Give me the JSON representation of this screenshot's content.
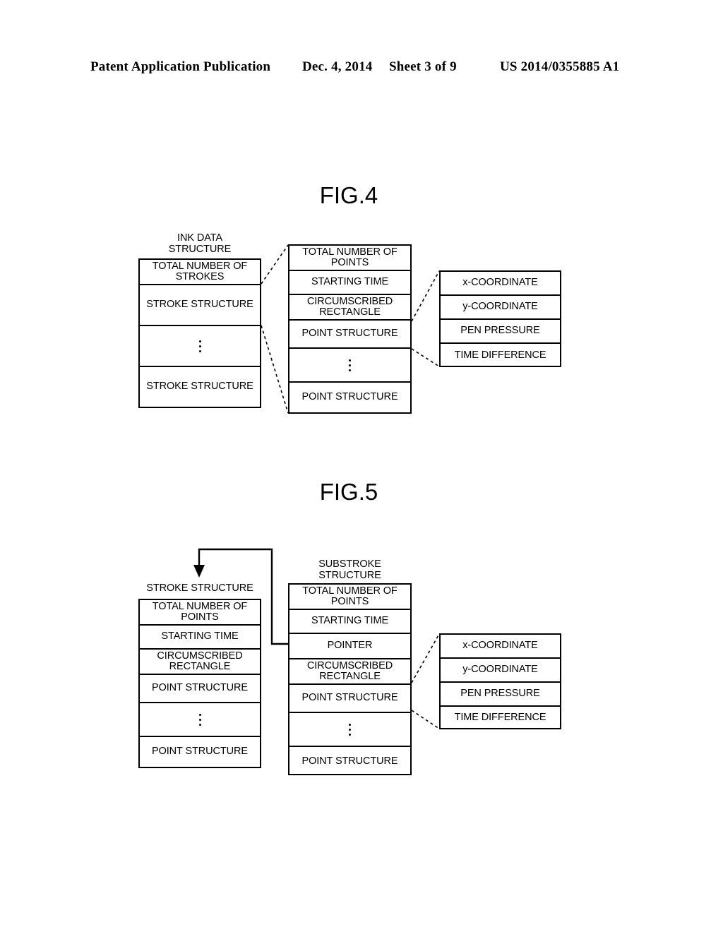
{
  "header": {
    "publication": "Patent Application Publication",
    "date": "Dec. 4, 2014",
    "sheet": "Sheet 3 of 9",
    "number": "US 2014/0355885 A1"
  },
  "figures": [
    {
      "title": "FIG.4",
      "columns": [
        {
          "caption": "INK DATA\nSTRUCTURE",
          "caption_line1": "INK DATA",
          "caption_line2": "STRUCTURE",
          "rows": [
            {
              "label": "TOTAL NUMBER OF STROKES",
              "type": "text"
            },
            {
              "label": "STROKE STRUCTURE",
              "type": "text"
            },
            {
              "label": "",
              "type": "ellipsis"
            },
            {
              "label": "STROKE STRUCTURE",
              "type": "text"
            }
          ]
        },
        {
          "caption": "",
          "rows": [
            {
              "label": "TOTAL NUMBER OF POINTS",
              "type": "text"
            },
            {
              "label": "STARTING TIME",
              "type": "text"
            },
            {
              "label": "CIRCUMSCRIBED RECTANGLE",
              "type": "text"
            },
            {
              "label": "POINT STRUCTURE",
              "type": "text"
            },
            {
              "label": "",
              "type": "ellipsis"
            },
            {
              "label": "POINT STRUCTURE",
              "type": "text"
            }
          ]
        },
        {
          "caption": "",
          "rows": [
            {
              "label": "x-COORDINATE",
              "type": "text"
            },
            {
              "label": "y-COORDINATE",
              "type": "text"
            },
            {
              "label": "PEN PRESSURE",
              "type": "text"
            },
            {
              "label": "TIME DIFFERENCE",
              "type": "text"
            }
          ]
        }
      ]
    },
    {
      "title": "FIG.5",
      "columns": [
        {
          "caption": "STROKE STRUCTURE",
          "rows": [
            {
              "label": "TOTAL NUMBER OF POINTS",
              "type": "text"
            },
            {
              "label": "STARTING TIME",
              "type": "text"
            },
            {
              "label": "CIRCUMSCRIBED RECTANGLE",
              "type": "text"
            },
            {
              "label": "POINT STRUCTURE",
              "type": "text"
            },
            {
              "label": "",
              "type": "ellipsis"
            },
            {
              "label": "POINT STRUCTURE",
              "type": "text"
            }
          ]
        },
        {
          "caption_line1": "SUBSTROKE",
          "caption_line2": "STRUCTURE",
          "rows": [
            {
              "label": "TOTAL NUMBER OF POINTS",
              "type": "text"
            },
            {
              "label": "STARTING TIME",
              "type": "text"
            },
            {
              "label": "POINTER",
              "type": "text"
            },
            {
              "label": "CIRCUMSCRIBED RECTANGLE",
              "type": "text"
            },
            {
              "label": "POINT STRUCTURE",
              "type": "text"
            },
            {
              "label": "",
              "type": "ellipsis"
            },
            {
              "label": "POINT STRUCTURE",
              "type": "text"
            }
          ]
        },
        {
          "caption": "",
          "rows": [
            {
              "label": "x-COORDINATE",
              "type": "text"
            },
            {
              "label": "y-COORDINATE",
              "type": "text"
            },
            {
              "label": "PEN PRESSURE",
              "type": "text"
            },
            {
              "label": "TIME DIFFERENCE",
              "type": "text"
            }
          ]
        }
      ]
    }
  ],
  "colors": {
    "ink": "#000000",
    "paper": "#ffffff"
  }
}
